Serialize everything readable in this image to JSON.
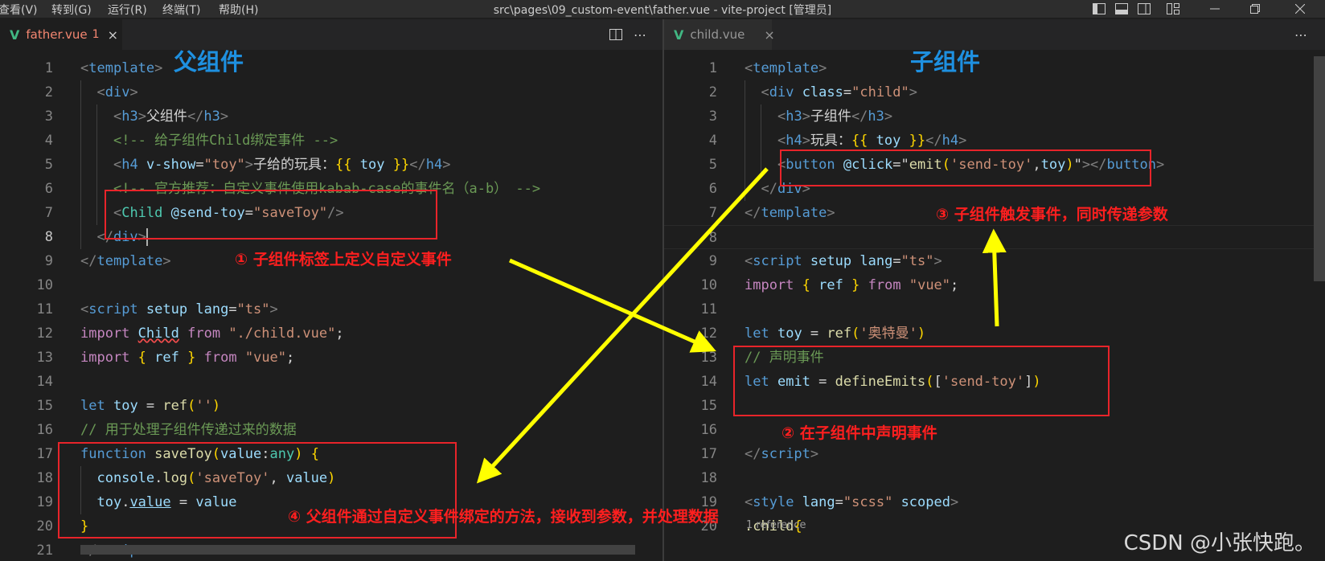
{
  "menubar": {
    "items": [
      "查看(V)",
      "转到(G)",
      "运行(R)",
      "终端(T)",
      "帮助(H)"
    ],
    "title": "src\\pages\\09_custom-event\\father.vue - vite-project [管理员]"
  },
  "left": {
    "tab": {
      "icon": "V",
      "label": "father.vue",
      "badge": "1",
      "close": "×"
    },
    "heading": "父组件",
    "lines": [
      {
        "n": "1",
        "t": [
          [
            "tg",
            "<"
          ],
          [
            "tn",
            "template"
          ],
          [
            "tg",
            ">"
          ]
        ]
      },
      {
        "n": "2",
        "t": [
          [
            "tg",
            "<"
          ],
          [
            "tn",
            "div"
          ],
          [
            "tg",
            ">"
          ]
        ]
      },
      {
        "n": "3",
        "t": [
          [
            "tg",
            "<"
          ],
          [
            "tn",
            "h3"
          ],
          [
            "tg",
            ">"
          ],
          [
            "tx",
            "父组件"
          ],
          [
            "tg",
            "</"
          ],
          [
            "tn",
            "h3"
          ],
          [
            "tg",
            ">"
          ]
        ]
      },
      {
        "n": "4",
        "t": [
          [
            "cm",
            "<!-- 给子组件Child绑定事件 -->"
          ]
        ]
      },
      {
        "n": "5",
        "t": [
          [
            "tg",
            "<"
          ],
          [
            "tn",
            "h4"
          ],
          [
            "tx",
            " "
          ],
          [
            "at",
            "v-show"
          ],
          [
            "tx",
            "="
          ],
          [
            "st",
            "\"toy\""
          ],
          [
            "tg",
            ">"
          ],
          [
            "tx",
            "子给的玩具："
          ],
          [
            "br",
            "{{"
          ],
          [
            "tx",
            " "
          ],
          [
            "vr",
            "toy"
          ],
          [
            "tx",
            " "
          ],
          [
            "br",
            "}}"
          ],
          [
            "tg",
            "</"
          ],
          [
            "tn",
            "h4"
          ],
          [
            "tg",
            ">"
          ]
        ]
      },
      {
        "n": "6",
        "t": [
          [
            "cm",
            "<!-- 官方推荐：自定义事件使用kabab-case的事件名（a-b） -->"
          ]
        ]
      },
      {
        "n": "7",
        "t": [
          [
            "tg",
            "<"
          ],
          [
            "ty",
            "Child"
          ],
          [
            "tx",
            " "
          ],
          [
            "at",
            "@send-toy"
          ],
          [
            "tx",
            "="
          ],
          [
            "st",
            "\"saveToy\""
          ],
          [
            "tg",
            "/>"
          ]
        ]
      },
      {
        "n": "8",
        "t": [
          [
            "tg",
            "</"
          ],
          [
            "tn",
            "div"
          ],
          [
            "tg",
            ">"
          ]
        ]
      },
      {
        "n": "9",
        "t": [
          [
            "tg",
            "</"
          ],
          [
            "tn",
            "template"
          ],
          [
            "tg",
            ">"
          ]
        ]
      },
      {
        "n": "10",
        "t": []
      },
      {
        "n": "11",
        "t": [
          [
            "tg",
            "<"
          ],
          [
            "tn",
            "script"
          ],
          [
            "tx",
            " "
          ],
          [
            "at",
            "setup"
          ],
          [
            "tx",
            " "
          ],
          [
            "at",
            "lang"
          ],
          [
            "tx",
            "="
          ],
          [
            "st",
            "\"ts\""
          ],
          [
            "tg",
            ">"
          ]
        ]
      },
      {
        "n": "12",
        "t": [
          [
            "ck",
            "import"
          ],
          [
            "tx",
            " "
          ],
          [
            "vr",
            "Child"
          ],
          [
            "tx",
            " "
          ],
          [
            "ck",
            "from"
          ],
          [
            "tx",
            " "
          ],
          [
            "st",
            "\"./child.vue\""
          ],
          [
            "tx",
            ";"
          ]
        ]
      },
      {
        "n": "13",
        "t": [
          [
            "ck",
            "import"
          ],
          [
            "tx",
            " "
          ],
          [
            "br",
            "{"
          ],
          [
            "tx",
            " "
          ],
          [
            "vr",
            "ref"
          ],
          [
            "tx",
            " "
          ],
          [
            "br",
            "}"
          ],
          [
            "tx",
            " "
          ],
          [
            "ck",
            "from"
          ],
          [
            "tx",
            " "
          ],
          [
            "st",
            "\"vue\""
          ],
          [
            "tx",
            ";"
          ]
        ]
      },
      {
        "n": "14",
        "t": []
      },
      {
        "n": "15",
        "t": [
          [
            "kw",
            "let"
          ],
          [
            "tx",
            " "
          ],
          [
            "vr",
            "toy"
          ],
          [
            "tx",
            " = "
          ],
          [
            "fn",
            "ref"
          ],
          [
            "br",
            "("
          ],
          [
            "st",
            "''"
          ],
          [
            "br",
            ")"
          ]
        ]
      },
      {
        "n": "16",
        "t": [
          [
            "cm",
            "// 用于处理子组件传递过来的数据"
          ]
        ]
      },
      {
        "n": "17",
        "t": [
          [
            "kw",
            "function"
          ],
          [
            "tx",
            " "
          ],
          [
            "fn",
            "saveToy"
          ],
          [
            "br",
            "("
          ],
          [
            "vr",
            "value"
          ],
          [
            "tx",
            ":"
          ],
          [
            "ty",
            "any"
          ],
          [
            "br",
            ")"
          ],
          [
            "tx",
            " "
          ],
          [
            "br",
            "{"
          ]
        ]
      },
      {
        "n": "18",
        "t": [
          [
            "vr",
            "console"
          ],
          [
            "tx",
            "."
          ],
          [
            "fn",
            "log"
          ],
          [
            "br",
            "("
          ],
          [
            "st",
            "'saveToy'"
          ],
          [
            "tx",
            ", "
          ],
          [
            "vr",
            "value"
          ],
          [
            "br",
            ")"
          ]
        ]
      },
      {
        "n": "19",
        "t": [
          [
            "vr",
            "toy"
          ],
          [
            "tx",
            "."
          ],
          [
            "vr",
            "value"
          ],
          [
            "tx",
            " = "
          ],
          [
            "vr",
            "value"
          ]
        ]
      },
      {
        "n": "20",
        "t": [
          [
            "br",
            "}"
          ]
        ]
      },
      {
        "n": "21",
        "t": [
          [
            "tg",
            "</"
          ],
          [
            "tn",
            "script"
          ],
          [
            "tg",
            ">"
          ]
        ]
      }
    ]
  },
  "right": {
    "tab": {
      "icon": "V",
      "label": "child.vue",
      "close": "×"
    },
    "heading": "子组件",
    "codelens": "1 reference",
    "lines": [
      {
        "n": "1",
        "t": [
          [
            "tg",
            "<"
          ],
          [
            "tn",
            "template"
          ],
          [
            "tg",
            ">"
          ]
        ]
      },
      {
        "n": "2",
        "t": [
          [
            "tg",
            "<"
          ],
          [
            "tn",
            "div"
          ],
          [
            "tx",
            " "
          ],
          [
            "at",
            "class"
          ],
          [
            "tx",
            "="
          ],
          [
            "st",
            "\"child\""
          ],
          [
            "tg",
            ">"
          ]
        ]
      },
      {
        "n": "3",
        "t": [
          [
            "tg",
            "<"
          ],
          [
            "tn",
            "h3"
          ],
          [
            "tg",
            ">"
          ],
          [
            "tx",
            "子组件"
          ],
          [
            "tg",
            "</"
          ],
          [
            "tn",
            "h3"
          ],
          [
            "tg",
            ">"
          ]
        ]
      },
      {
        "n": "4",
        "t": [
          [
            "tg",
            "<"
          ],
          [
            "tn",
            "h4"
          ],
          [
            "tg",
            ">"
          ],
          [
            "tx",
            "玩具："
          ],
          [
            "br",
            "{{"
          ],
          [
            "tx",
            " "
          ],
          [
            "vr",
            "toy"
          ],
          [
            "tx",
            " "
          ],
          [
            "br",
            "}}"
          ],
          [
            "tg",
            "</"
          ],
          [
            "tn",
            "h4"
          ],
          [
            "tg",
            ">"
          ]
        ]
      },
      {
        "n": "5",
        "t": [
          [
            "tg",
            "<"
          ],
          [
            "tn",
            "button"
          ],
          [
            "tx",
            " "
          ],
          [
            "at",
            "@click"
          ],
          [
            "tx",
            "=\""
          ],
          [
            "fn",
            "emit"
          ],
          [
            "br",
            "("
          ],
          [
            "st",
            "'send-toy'"
          ],
          [
            "tx",
            ","
          ],
          [
            "vr",
            "toy"
          ],
          [
            "br",
            ")"
          ],
          [
            "tx",
            "\""
          ],
          [
            "tg",
            "></"
          ],
          [
            "tn",
            "button"
          ],
          [
            "tg",
            ">"
          ]
        ]
      },
      {
        "n": "6",
        "t": [
          [
            "tg",
            "</"
          ],
          [
            "tn",
            "div"
          ],
          [
            "tg",
            ">"
          ]
        ]
      },
      {
        "n": "7",
        "t": [
          [
            "tg",
            "</"
          ],
          [
            "tn",
            "template"
          ],
          [
            "tg",
            ">"
          ]
        ]
      },
      {
        "n": "8",
        "t": []
      },
      {
        "n": "9",
        "t": [
          [
            "tg",
            "<"
          ],
          [
            "tn",
            "script"
          ],
          [
            "tx",
            " "
          ],
          [
            "at",
            "setup"
          ],
          [
            "tx",
            " "
          ],
          [
            "at",
            "lang"
          ],
          [
            "tx",
            "="
          ],
          [
            "st",
            "\"ts\""
          ],
          [
            "tg",
            ">"
          ]
        ]
      },
      {
        "n": "10",
        "t": [
          [
            "ck",
            "import"
          ],
          [
            "tx",
            " "
          ],
          [
            "br",
            "{"
          ],
          [
            "tx",
            " "
          ],
          [
            "vr",
            "ref"
          ],
          [
            "tx",
            " "
          ],
          [
            "br",
            "}"
          ],
          [
            "tx",
            " "
          ],
          [
            "ck",
            "from"
          ],
          [
            "tx",
            " "
          ],
          [
            "st",
            "\"vue\""
          ],
          [
            "tx",
            ";"
          ]
        ]
      },
      {
        "n": "11",
        "t": []
      },
      {
        "n": "12",
        "t": [
          [
            "kw",
            "let"
          ],
          [
            "tx",
            " "
          ],
          [
            "vr",
            "toy"
          ],
          [
            "tx",
            " = "
          ],
          [
            "fn",
            "ref"
          ],
          [
            "br",
            "("
          ],
          [
            "st",
            "'奥特曼'"
          ],
          [
            "br",
            ")"
          ]
        ]
      },
      {
        "n": "13",
        "t": [
          [
            "cm",
            "// 声明事件"
          ]
        ]
      },
      {
        "n": "14",
        "t": [
          [
            "kw",
            "let"
          ],
          [
            "tx",
            " "
          ],
          [
            "vr",
            "emit"
          ],
          [
            "tx",
            " = "
          ],
          [
            "fn",
            "defineEmits"
          ],
          [
            "br",
            "("
          ],
          [
            "tx",
            "["
          ],
          [
            "st",
            "'send-toy'"
          ],
          [
            "tx",
            "]"
          ],
          [
            "br",
            ")"
          ]
        ]
      },
      {
        "n": "15",
        "t": []
      },
      {
        "n": "16",
        "t": []
      },
      {
        "n": "17",
        "t": [
          [
            "tg",
            "</"
          ],
          [
            "tn",
            "script"
          ],
          [
            "tg",
            ">"
          ]
        ]
      },
      {
        "n": "18",
        "t": []
      },
      {
        "n": "19",
        "t": [
          [
            "tg",
            "<"
          ],
          [
            "tn",
            "style"
          ],
          [
            "tx",
            " "
          ],
          [
            "at",
            "lang"
          ],
          [
            "tx",
            "="
          ],
          [
            "st",
            "\"scss\""
          ],
          [
            "tx",
            " "
          ],
          [
            "at",
            "scoped"
          ],
          [
            "tg",
            ">"
          ]
        ]
      },
      {
        "n": "20",
        "t": [
          [
            "fn",
            ".child"
          ],
          [
            "br",
            "{"
          ]
        ]
      }
    ]
  },
  "annotations": {
    "a1": "① 子组件标签上定义自定义事件",
    "a2": "② 在子组件中声明事件",
    "a3": "③ 子组件触发事件，同时传递参数",
    "a4": "④ 父组件通过自定义事件绑定的方法，接收到参数，并处理数据"
  },
  "watermark": "CSDN @小张快跑。",
  "colors": {
    "editor_bg": "#1e1e1e",
    "annotation_red": "#ff1f1f",
    "heading_blue": "#1e90e0",
    "arrow_yellow": "#ffff00",
    "vue_green": "#41b883"
  },
  "icons": [
    "split-editor-icon",
    "more-actions-icon",
    "layout-sidebar-icon",
    "layout-panel-icon",
    "layout-split-icon",
    "customize-layout-icon",
    "minimize-icon",
    "restore-icon",
    "close-icon"
  ]
}
